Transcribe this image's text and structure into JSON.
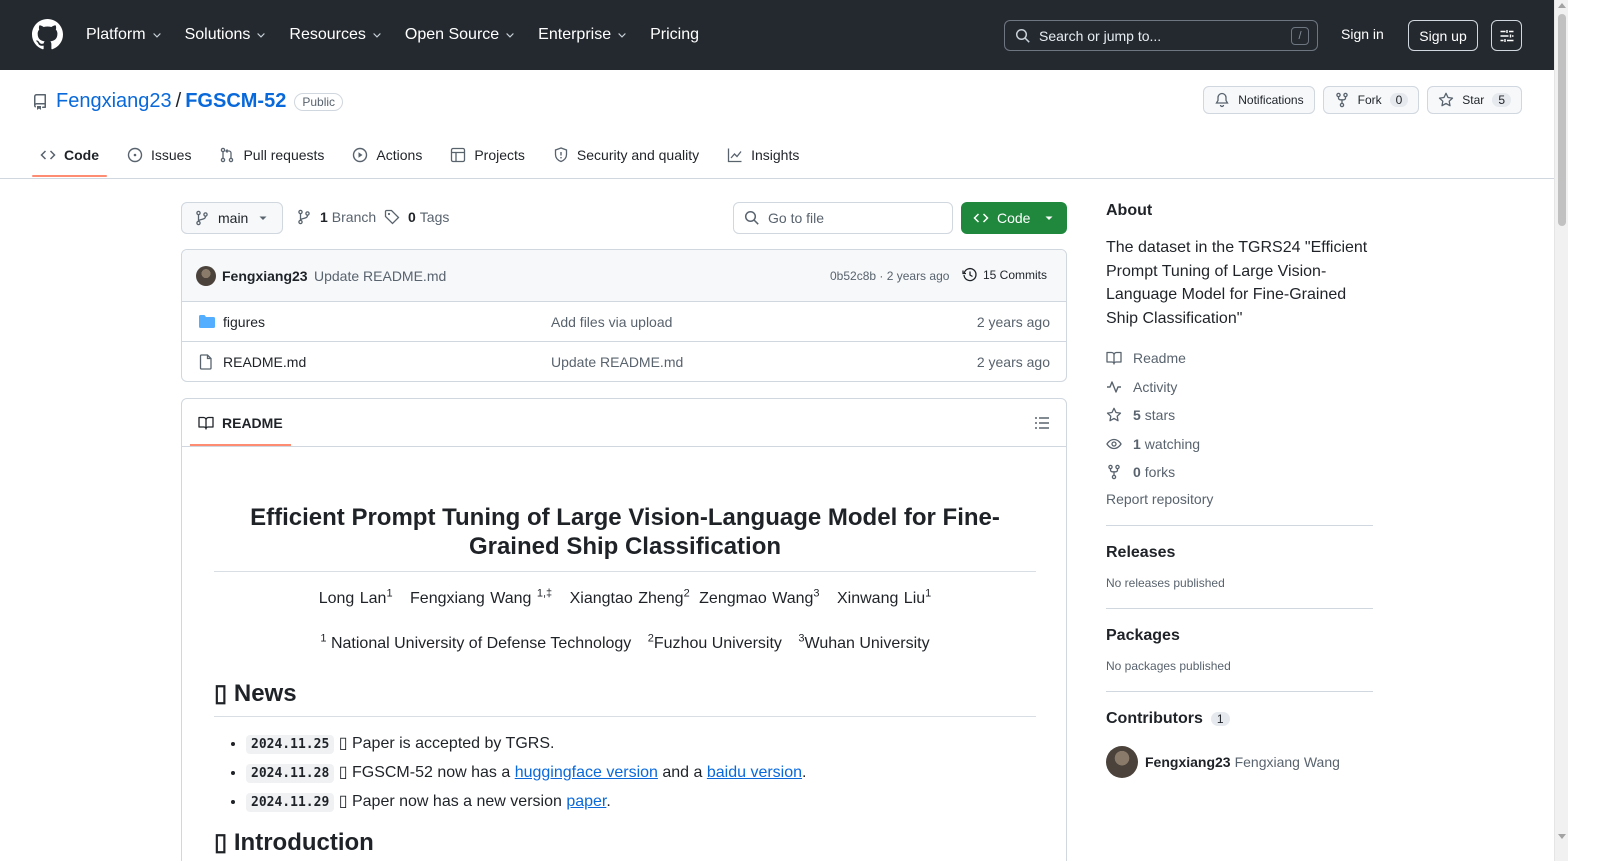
{
  "header": {
    "nav": [
      {
        "label": "Platform",
        "dropdown": true
      },
      {
        "label": "Solutions",
        "dropdown": true
      },
      {
        "label": "Resources",
        "dropdown": true
      },
      {
        "label": "Open Source",
        "dropdown": true
      },
      {
        "label": "Enterprise",
        "dropdown": true
      },
      {
        "label": "Pricing",
        "dropdown": false
      }
    ],
    "search_placeholder": "Search or jump to...",
    "search_key": "/",
    "sign_in": "Sign in",
    "sign_up": "Sign up"
  },
  "repo": {
    "owner": "Fengxiang23",
    "separator": "/",
    "name": "FGSCM-52",
    "visibility": "Public",
    "notifications_label": "Notifications",
    "fork_label": "Fork",
    "fork_count": "0",
    "star_label": "Star",
    "star_count": "5"
  },
  "tabs": [
    {
      "label": "Code",
      "icon": "code-icon",
      "active": true
    },
    {
      "label": "Issues",
      "icon": "issue-icon",
      "active": false
    },
    {
      "label": "Pull requests",
      "icon": "pull-request-icon",
      "active": false
    },
    {
      "label": "Actions",
      "icon": "actions-play-icon",
      "active": false
    },
    {
      "label": "Projects",
      "icon": "table-icon",
      "active": false
    },
    {
      "label": "Security and quality",
      "icon": "shield-icon",
      "active": false
    },
    {
      "label": "Insights",
      "icon": "graph-icon",
      "active": false
    }
  ],
  "controls": {
    "branch": "main",
    "branch_count": "1",
    "branch_label": "Branch",
    "tag_count": "0",
    "tag_label": "Tags",
    "goto_file": "Go to file",
    "code_button": "Code"
  },
  "latest_commit": {
    "author": "Fengxiang23",
    "message": "Update README.md",
    "meta": "0b52c8b · 2 years ago",
    "commits_label": "15 Commits"
  },
  "files": [
    {
      "name": "figures",
      "type": "folder",
      "message": "Add files via upload",
      "date": "2 years ago"
    },
    {
      "name": "README.md",
      "type": "file",
      "message": "Update README.md",
      "date": "2 years ago"
    }
  ],
  "readme": {
    "tab_label": "README",
    "title": "Efficient Prompt Tuning of Large Vision-Language Model for Fine-Grained Ship Classification",
    "authors": [
      {
        "name": "Long Lan",
        "sup": "1"
      },
      {
        "name": "Fengxiang Wang ",
        "sup": "1,‡"
      },
      {
        "name": "Xiangtao Zheng",
        "sup": "2"
      },
      {
        "name": "Zengmao Wang",
        "sup": "3"
      },
      {
        "name": "Xinwang Liu",
        "sup": "1"
      }
    ],
    "affiliations": [
      {
        "sup": "1",
        "name": " National University of Defense Technology"
      },
      {
        "sup": "2",
        "name": "Fuzhou University"
      },
      {
        "sup": "3",
        "name": "Wuhan University"
      }
    ],
    "news_heading": "▯ News",
    "news": [
      {
        "date": "2024.11.25",
        "pre": " ▯ Paper is accepted by TGRS.",
        "link": "",
        "mid": "",
        "link2": "",
        "post": ""
      },
      {
        "date": "2024.11.28",
        "pre": " ▯ FGSCM-52 now has a ",
        "link": "huggingface version",
        "mid": " and a ",
        "link2": "baidu version",
        "post": "."
      },
      {
        "date": "2024.11.29",
        "pre": " ▯ Paper now has a new version ",
        "link": "paper",
        "mid": "",
        "link2": "",
        "post": "."
      }
    ],
    "next_heading": "▯ Introduction"
  },
  "sidebar": {
    "about_heading": "About",
    "description": "The dataset in the TGRS24 \"Efficient Prompt Tuning of Large Vision-Language Model for Fine-Grained Ship Classification\"",
    "links": [
      {
        "icon": "book-icon",
        "count": "",
        "label": "Readme"
      },
      {
        "icon": "pulse-icon",
        "count": "",
        "label": "Activity"
      },
      {
        "icon": "star-icon",
        "count": "5",
        "label": "stars"
      },
      {
        "icon": "eye-icon",
        "count": "1",
        "label": "watching"
      },
      {
        "icon": "fork-icon",
        "count": "0",
        "label": "forks"
      }
    ],
    "report": "Report repository",
    "releases_heading": "Releases",
    "releases_empty": "No releases published",
    "packages_heading": "Packages",
    "packages_empty": "No packages published",
    "contributors_heading": "Contributors",
    "contributors_count": "1",
    "contributors": [
      {
        "login": "Fengxiang23",
        "name": "Fengxiang Wang"
      }
    ]
  },
  "colors": {
    "header_bg": "#24292f",
    "link": "#0969da",
    "primary_button": "#1f883d",
    "active_tab_underline": "#fd8c73"
  }
}
